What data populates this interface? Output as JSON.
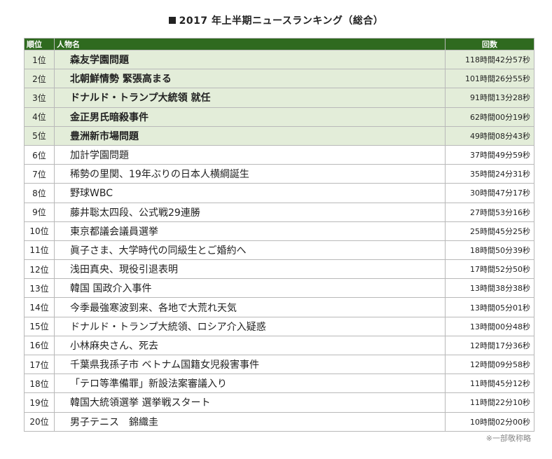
{
  "title": "2017 年上半期ニュースランキング（総合）",
  "headers": {
    "rank": "順位",
    "name": "人物名",
    "count": "回数"
  },
  "rows": [
    {
      "rank": "1位",
      "name": "森友学園問題",
      "count": "118時間42分57秒",
      "highlight": true
    },
    {
      "rank": "2位",
      "name": "北朝鮮情勢 緊張高まる",
      "count": "101時間26分55秒",
      "highlight": true
    },
    {
      "rank": "3位",
      "name": "ドナルド・トランプ大統領 就任",
      "count": "91時間13分28秒",
      "highlight": true
    },
    {
      "rank": "4位",
      "name": "金正男氏暗殺事件",
      "count": "62時間00分19秒",
      "highlight": true
    },
    {
      "rank": "5位",
      "name": "豊洲新市場問題",
      "count": "49時間08分43秒",
      "highlight": true
    },
    {
      "rank": "6位",
      "name": "加計学園問題",
      "count": "37時間49分59秒",
      "highlight": false
    },
    {
      "rank": "7位",
      "name": "稀勢の里関、19年ぶりの日本人横綱誕生",
      "count": "35時間24分31秒",
      "highlight": false
    },
    {
      "rank": "8位",
      "name": "野球WBC",
      "count": "30時間47分17秒",
      "highlight": false
    },
    {
      "rank": "9位",
      "name": "藤井聡太四段、公式戦29連勝",
      "count": "27時間53分16秒",
      "highlight": false
    },
    {
      "rank": "10位",
      "name": "東京都議会議員選挙",
      "count": "25時間45分25秒",
      "highlight": false
    },
    {
      "rank": "11位",
      "name": "眞子さま、大学時代の同級生とご婚約へ",
      "count": "18時間50分39秒",
      "highlight": false
    },
    {
      "rank": "12位",
      "name": "浅田真央、現役引退表明",
      "count": "17時間52分50秒",
      "highlight": false
    },
    {
      "rank": "13位",
      "name": "韓国 国政介入事件",
      "count": "13時間38分38秒",
      "highlight": false
    },
    {
      "rank": "14位",
      "name": "今季最強寒波到来、各地で大荒れ天気",
      "count": "13時間05分01秒",
      "highlight": false
    },
    {
      "rank": "15位",
      "name": "ドナルド・トランプ大統領、ロシア介入疑惑",
      "count": "13時間00分48秒",
      "highlight": false
    },
    {
      "rank": "16位",
      "name": "小林麻央さん、死去",
      "count": "12時間17分36秒",
      "highlight": false
    },
    {
      "rank": "17位",
      "name": "千葉県我孫子市 ベトナム国籍女児殺害事件",
      "count": "12時間09分58秒",
      "highlight": false
    },
    {
      "rank": "18位",
      "name": "「テロ等準備罪」新設法案審議入り",
      "count": "11時間45分12秒",
      "highlight": false
    },
    {
      "rank": "19位",
      "name": "韓国大統領選挙 選挙戦スタート",
      "count": "11時間22分10秒",
      "highlight": false
    },
    {
      "rank": "20位",
      "name": "男子テニス　錦織圭",
      "count": "10時間02分00秒",
      "highlight": false
    }
  ],
  "note": "※一部敬称略",
  "colors": {
    "header_bg": "#2f6a1f",
    "highlight_bg": "#e3edd9",
    "border": "#b9b9b9"
  }
}
